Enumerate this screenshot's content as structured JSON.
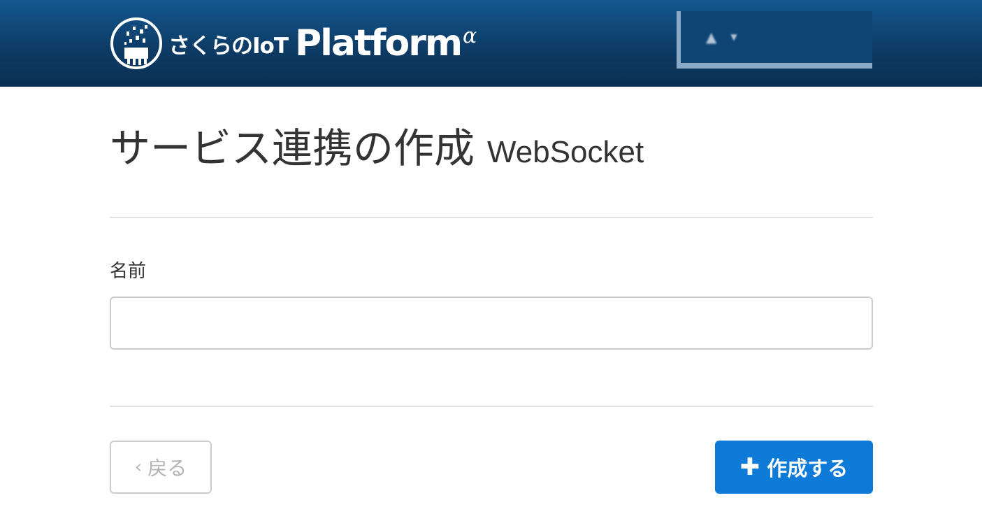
{
  "header": {
    "logo_ja": "さくらのIoT",
    "logo_platform": "Platform",
    "logo_alpha": "α",
    "logo_icon": "sakura-iot-logo-icon",
    "user_menu": {
      "icon": "user-icon",
      "name": "",
      "caret_icon": "caret-down-icon"
    }
  },
  "page": {
    "title": "サービス連携の作成",
    "title_sub": "WebSocket"
  },
  "form": {
    "name_label": "名前",
    "name_value": "",
    "name_placeholder": ""
  },
  "actions": {
    "back_label": "戻る",
    "back_icon": "chevron-left-icon",
    "create_label": "作成する",
    "create_icon": "plus-icon"
  },
  "colors": {
    "header_bg": "#0d3c66",
    "primary": "#0f7bd9",
    "border": "#cccccc",
    "text": "#333333"
  }
}
